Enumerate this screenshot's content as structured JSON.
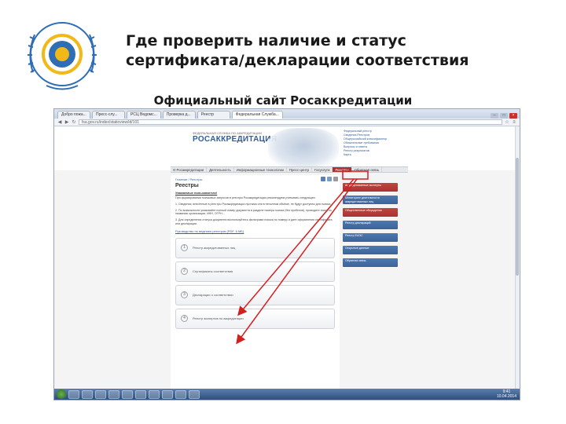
{
  "slide": {
    "title_line1": "Где проверить наличие и статус",
    "title_line2": "сертификата/декларации соответствия",
    "subtitle": "Официальный сайт Росаккредитации"
  },
  "browser": {
    "tabs": [
      "Добро пожа...",
      "Пресс-слу...",
      "РСЦ Ведомс...",
      "Проверка д...",
      "Реестр",
      "Федеральная Служба..."
    ],
    "active_tab": "Федеральная Служба...",
    "url": "fsa.gov.ru/index/staticview/id/101"
  },
  "site": {
    "logo_top": "ФЕДЕРАЛЬНАЯ СЛУЖБА ПО АККРЕДИТАЦИИ",
    "logo_name": "РОСАККРЕДИТАЦИЯ",
    "header_links": [
      "Федеральный реестр",
      "Сведения Реестров",
      "Общероссийский классификатор",
      "Обязательные требования",
      "Вопросы и ответы",
      "Реестр результатов",
      "Карта"
    ],
    "nav": [
      "О Росаккредитации",
      "Деятельность",
      "Информационные технологии",
      "Пресс-центр",
      "Госуслуги",
      "Реестры",
      "Обратная связь"
    ],
    "active_nav": "Реестры",
    "breadcrumb": "Главная / Реестры",
    "page_heading": "Реестры",
    "intro_label": "Уважаемые пользователи!",
    "paragraphs": [
      "При формировании поисковых запросов в реестры Росаккредитации рекомендуем учитывать следующее:",
      "1. Сведения, внесённые в реестры Росаккредитации пустыми или в неполном объёме, не будут доступны для поиска...",
      "2. По возможности указывайте полный номер документа в разделе номера поиска (без пробелов), проводите поиск по названию организации, ИНН, ОГРН...",
      "3. Для определения статуса документа воспользуйтесь фильтрами поиска по номеру и дате оформления сертификата или декларации."
    ],
    "doc_link": "Руководство по ведению реестров (PDF, 6 МБ)",
    "registers": [
      {
        "num": "1",
        "label": "Реестр аккредитованных лиц"
      },
      {
        "num": "2",
        "label": "Сертификаты соответствия"
      },
      {
        "num": "3",
        "label": "Декларации о соответствии"
      },
      {
        "num": "4",
        "label": "Реестр экспертов по аккредитации"
      }
    ],
    "sidebar": [
      "Аккредитованные эксперты",
      "Мониторинг деятельности аккредитованных лиц",
      "Общественные обсуждения",
      "Реестр деклараций",
      "Реестр ЕАЭС",
      "Открытые данные",
      "Обратная связь"
    ]
  },
  "taskbar": {
    "time": "9:41",
    "date": "10.04.2014"
  }
}
